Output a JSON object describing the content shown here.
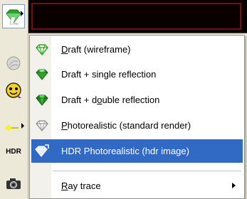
{
  "toolbar": {
    "tools": [
      {
        "name": "render-mode-tool",
        "icon": "gem-icon"
      },
      {
        "name": "material-tool",
        "icon": "sphere-icon"
      },
      {
        "name": "lighting-tool",
        "icon": "face-icon"
      },
      {
        "name": "pointer-tool",
        "icon": "wand-icon"
      },
      {
        "name": "hdr-tool",
        "label": "HDR"
      },
      {
        "name": "camera-tool",
        "icon": "camera-icon"
      }
    ]
  },
  "menu": {
    "items": [
      {
        "label": "Draft (wireframe)",
        "mnemonic": "D",
        "icon": "gem-wireframe-icon"
      },
      {
        "label": "Draft + single reflection",
        "icon": "gem-single-icon"
      },
      {
        "label": "Draft + double reflection",
        "mnemonic": "o",
        "icon": "gem-double-icon"
      },
      {
        "label": "Photorealistic (standard render)",
        "mnemonic": "P",
        "icon": "gem-outline-icon"
      },
      {
        "label": "HDR Photorealistic (hdr image)",
        "icon": "gem-hdr-icon",
        "highlighted": true
      },
      {
        "label": "Ray trace",
        "mnemonic": "R",
        "submenu": true
      }
    ]
  },
  "colors": {
    "highlight": "#316ac5",
    "gem_green": "#2ba62b",
    "viewport_border": "#7a0c0c"
  }
}
